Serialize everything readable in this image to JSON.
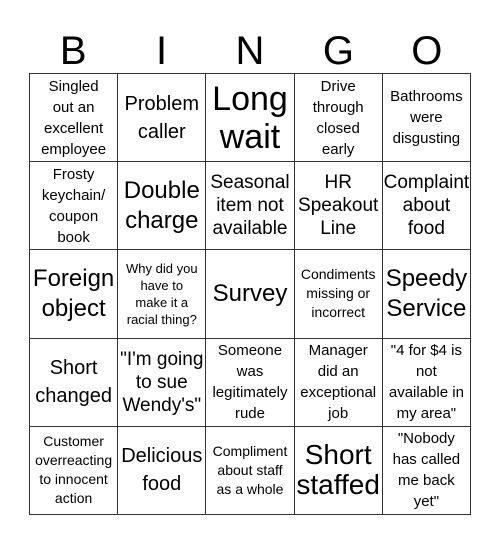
{
  "header": {
    "letters": [
      "B",
      "I",
      "N",
      "G",
      "O"
    ]
  },
  "cells": [
    "Singled\nout an\nexcellent\nemployee",
    "Problem\ncaller",
    "Long\nwait",
    "Drive\nthrough\nclosed\nearly",
    "Bathrooms\nwere\ndisgusting",
    "Frosty\nkeychain/\ncoupon\nbook",
    "Double\ncharge",
    "Seasonal\nitem not\navailable",
    "HR\nSpeakout\nLine",
    "Complaint\nabout\nfood",
    "Foreign\nobject",
    "Why did you\nhave to\nmake it a\nracial thing?",
    "Survey",
    "Condiments\nmissing or\nincorrect",
    "Speedy\nService",
    "Short\nchanged",
    "\"I'm going\nto sue\nWendy's\"",
    "Someone\nwas\nlegitimately\nrude",
    "Manager\ndid an\nexceptional\njob",
    "\"4 for $4 is\nnot\navailable in\nmy area\"",
    "Customer\noverreacting\nto innocent\naction",
    "Delicious\nfood",
    "Compliment\nabout staff\nas a whole",
    "Short\nstaffed",
    "\"Nobody\nhas called\nme back\nyet\""
  ]
}
